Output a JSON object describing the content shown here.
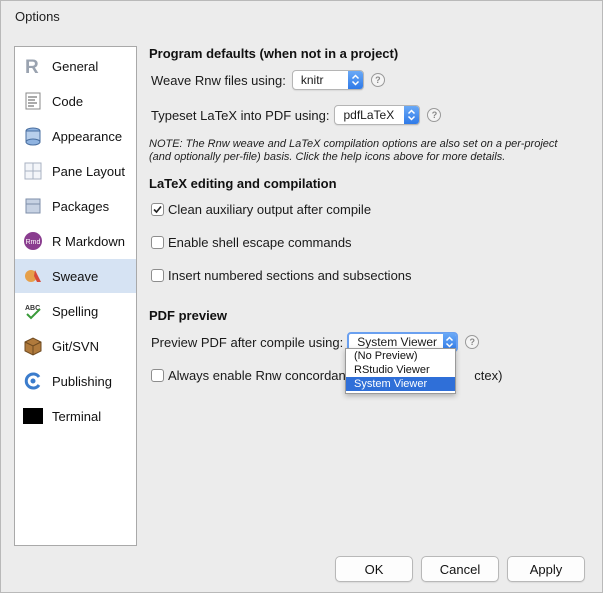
{
  "window": {
    "title": "Options"
  },
  "sidebar": {
    "items": [
      {
        "label": "General",
        "icon": "r-logo-icon"
      },
      {
        "label": "Code",
        "icon": "code-icon"
      },
      {
        "label": "Appearance",
        "icon": "appearance-icon"
      },
      {
        "label": "Pane Layout",
        "icon": "pane-layout-icon"
      },
      {
        "label": "Packages",
        "icon": "packages-icon"
      },
      {
        "label": "R Markdown",
        "icon": "rmarkdown-icon"
      },
      {
        "label": "Sweave",
        "icon": "sweave-icon"
      },
      {
        "label": "Spelling",
        "icon": "spelling-icon"
      },
      {
        "label": "Git/SVN",
        "icon": "git-icon"
      },
      {
        "label": "Publishing",
        "icon": "publishing-icon"
      },
      {
        "label": "Terminal",
        "icon": "terminal-icon"
      }
    ],
    "selected": "Sweave"
  },
  "sweave": {
    "program_defaults_heading": "Program defaults (when not in a project)",
    "weave_label": "Weave Rnw files using:",
    "weave_value": "knitr",
    "typeset_label": "Typeset LaTeX into PDF using:",
    "typeset_value": "pdfLaTeX",
    "note_line1": "NOTE: The Rnw weave and LaTeX compilation options are also set on a per-project",
    "note_line2": "(and optionally per-file) basis. Click the help icons above for more details.",
    "latex_heading": "LaTeX editing and compilation",
    "clean_aux_label": "Clean auxiliary output after compile",
    "clean_aux_checked": true,
    "shell_escape_label": "Enable shell escape commands",
    "shell_escape_checked": false,
    "numbered_sections_label": "Insert numbered sections and subsections",
    "numbered_sections_checked": false,
    "pdf_heading": "PDF preview",
    "preview_label": "Preview PDF after compile using:",
    "preview_value": "System Viewer",
    "preview_options": [
      "(No Preview)",
      "RStudio Viewer",
      "System Viewer"
    ],
    "concordance_label_start": "Always enable Rnw concordanc",
    "concordance_label_end": "ctex)",
    "concordance_checked": false
  },
  "buttons": {
    "ok": "OK",
    "cancel": "Cancel",
    "apply": "Apply"
  },
  "colors": {
    "selection": "#2f6fd8",
    "sidebar_active": "#d6e3f3",
    "accent": "#2f7ae8"
  }
}
